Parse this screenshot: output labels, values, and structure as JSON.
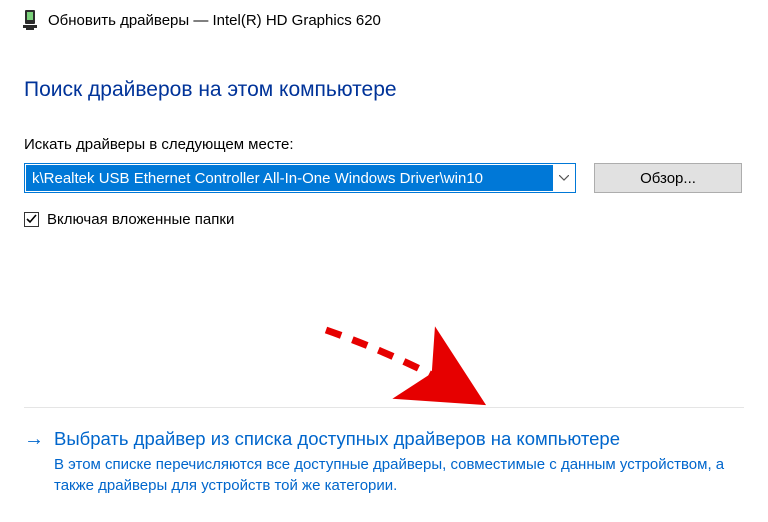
{
  "titlebar": {
    "title": "Обновить драйверы — Intel(R) HD Graphics 620"
  },
  "heading": "Поиск драйверов на этом компьютере",
  "search": {
    "label": "Искать драйверы в следующем месте:",
    "path_value": "k\\Realtek USB Ethernet Controller All-In-One Windows Driver\\win10",
    "browse_label": "Обзор..."
  },
  "include_subfolders": {
    "label": "Включая вложенные папки",
    "checked": true
  },
  "pick_option": {
    "title": "Выбрать драйвер из списка доступных драйверов на компьютере",
    "description": "В этом списке перечисляются все доступные драйверы, совместимые с данным устройством, а также драйверы для устройств той же категории."
  }
}
